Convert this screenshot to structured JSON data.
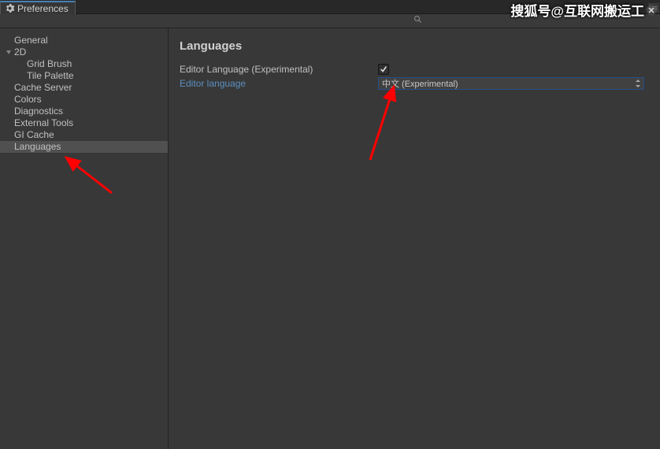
{
  "tab": {
    "title": "Preferences"
  },
  "sidebar": {
    "items": [
      {
        "label": "General"
      },
      {
        "label": "2D"
      },
      {
        "label": "Grid Brush"
      },
      {
        "label": "Tile Palette"
      },
      {
        "label": "Cache Server"
      },
      {
        "label": "Colors"
      },
      {
        "label": "Diagnostics"
      },
      {
        "label": "External Tools"
      },
      {
        "label": "GI Cache"
      },
      {
        "label": "Languages"
      }
    ]
  },
  "main": {
    "heading": "Languages",
    "rows": [
      {
        "label": "Editor Language (Experimental)",
        "checked": true
      },
      {
        "label": "Editor language",
        "dropdown_value": "中文 (Experimental)"
      }
    ]
  },
  "watermark": "搜狐号@互联网搬运工"
}
